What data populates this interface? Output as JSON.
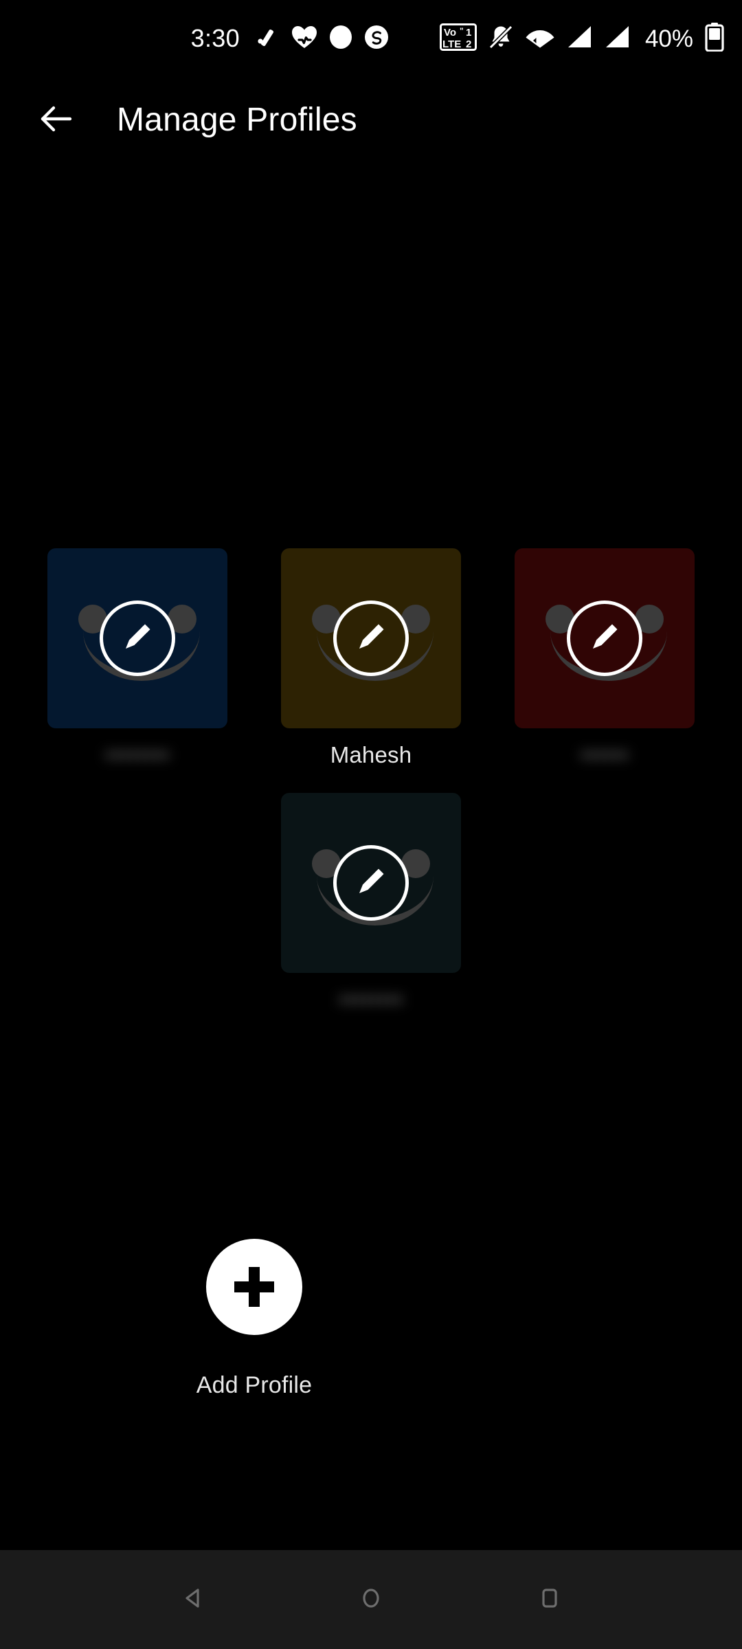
{
  "status_bar": {
    "clock": "3:30",
    "left_icons": [
      "checkmark-slash-icon",
      "heart-pulse-icon",
      "circle-filled-icon",
      "loop-circle-icon"
    ],
    "right_icons": [
      "volte-dual-sim-icon",
      "notifications-muted-icon",
      "wifi-icon",
      "signal-sim1-icon",
      "signal-sim2-icon"
    ],
    "volte_label_top": "Vo",
    "volte_label_bottom": "LTE",
    "sim1": "1",
    "sim2": "2",
    "battery_percent": "40%",
    "battery_icon": "battery-icon"
  },
  "app_bar": {
    "back_icon": "back-arrow-icon",
    "title": "Manage Profiles"
  },
  "profiles": [
    {
      "name": "••••••••",
      "redacted": true,
      "color": "#04182f",
      "edit_icon": "pencil-edit-icon"
    },
    {
      "name": "Mahesh",
      "redacted": false,
      "color": "#2d2203",
      "edit_icon": "pencil-edit-icon"
    },
    {
      "name": "••••••",
      "redacted": true,
      "color": "#300505",
      "edit_icon": "pencil-edit-icon"
    },
    {
      "name": "••••••••",
      "redacted": true,
      "color": "#0a1416",
      "edit_icon": "pencil-edit-icon"
    }
  ],
  "add_profile": {
    "icon": "plus-icon",
    "label": "Add Profile"
  },
  "nav_bar": {
    "back": "nav-back-icon",
    "home": "nav-home-icon",
    "recents": "nav-recents-icon"
  },
  "colors": {
    "background": "#000000",
    "text_primary": "#ffffff",
    "text_secondary": "#e8e8e8",
    "nav_bar_bg": "#1b1b1b",
    "nav_icon": "#6e6e6e",
    "face_feature": "#3b3b3b"
  }
}
